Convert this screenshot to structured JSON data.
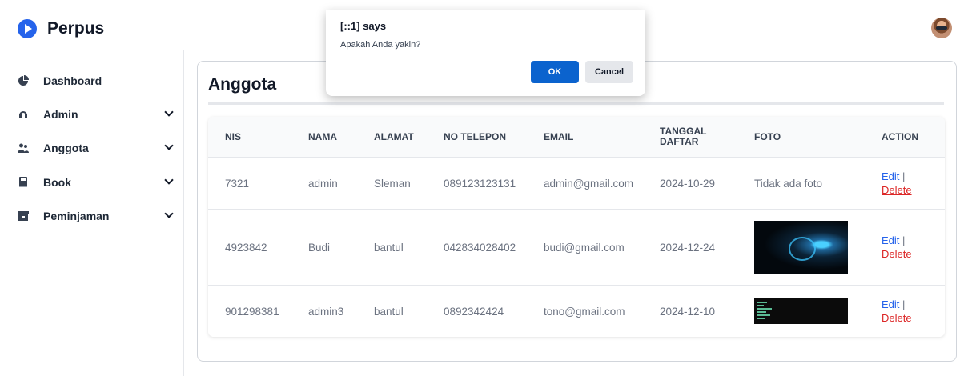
{
  "app": {
    "brand": "Perpus",
    "avatar_icon": "user-avatar"
  },
  "sidebar": {
    "items": [
      {
        "label": "Dashboard",
        "icon": "pie-chart-icon",
        "has_chevron": false
      },
      {
        "label": "Admin",
        "icon": "user-outline-icon",
        "has_chevron": true
      },
      {
        "label": "Anggota",
        "icon": "users-icon",
        "has_chevron": true
      },
      {
        "label": "Book",
        "icon": "book-icon",
        "has_chevron": true
      },
      {
        "label": "Peminjaman",
        "icon": "archive-icon",
        "has_chevron": true
      }
    ]
  },
  "page": {
    "title": "Anggota"
  },
  "table": {
    "columns": [
      "NIS",
      "NAMA",
      "ALAMAT",
      "NO TELEPON",
      "EMAIL",
      "TANGGAL DAFTAR",
      "FOTO",
      "ACTION"
    ],
    "rows": [
      {
        "nis": "7321",
        "nama": "admin",
        "alamat": "Sleman",
        "telepon": "089123123131",
        "email": "admin@gmail.com",
        "tanggal": "2024-10-29",
        "foto": "Tidak ada foto",
        "edit": "Edit",
        "separator": "|",
        "delete": "Delete"
      },
      {
        "nis": "4923842",
        "nama": "Budi",
        "alamat": "bantul",
        "telepon": "042834028402",
        "email": "budi@gmail.com",
        "tanggal": "2024-12-24",
        "foto": "",
        "edit": "Edit",
        "separator": "|",
        "delete": "Delete"
      },
      {
        "nis": "901298381",
        "nama": "admin3",
        "alamat": "bantul",
        "telepon": "0892342424",
        "email": "tono@gmail.com",
        "tanggal": "2024-12-10",
        "foto": "",
        "edit": "Edit",
        "separator": "|",
        "delete": "Delete"
      }
    ]
  },
  "dialog": {
    "title": "[::1] says",
    "message": "Apakah Anda yakin?",
    "ok_label": "OK",
    "cancel_label": "Cancel"
  },
  "colors": {
    "accent": "#2563eb",
    "danger": "#dc2626",
    "ok_button": "#0b63ce"
  }
}
